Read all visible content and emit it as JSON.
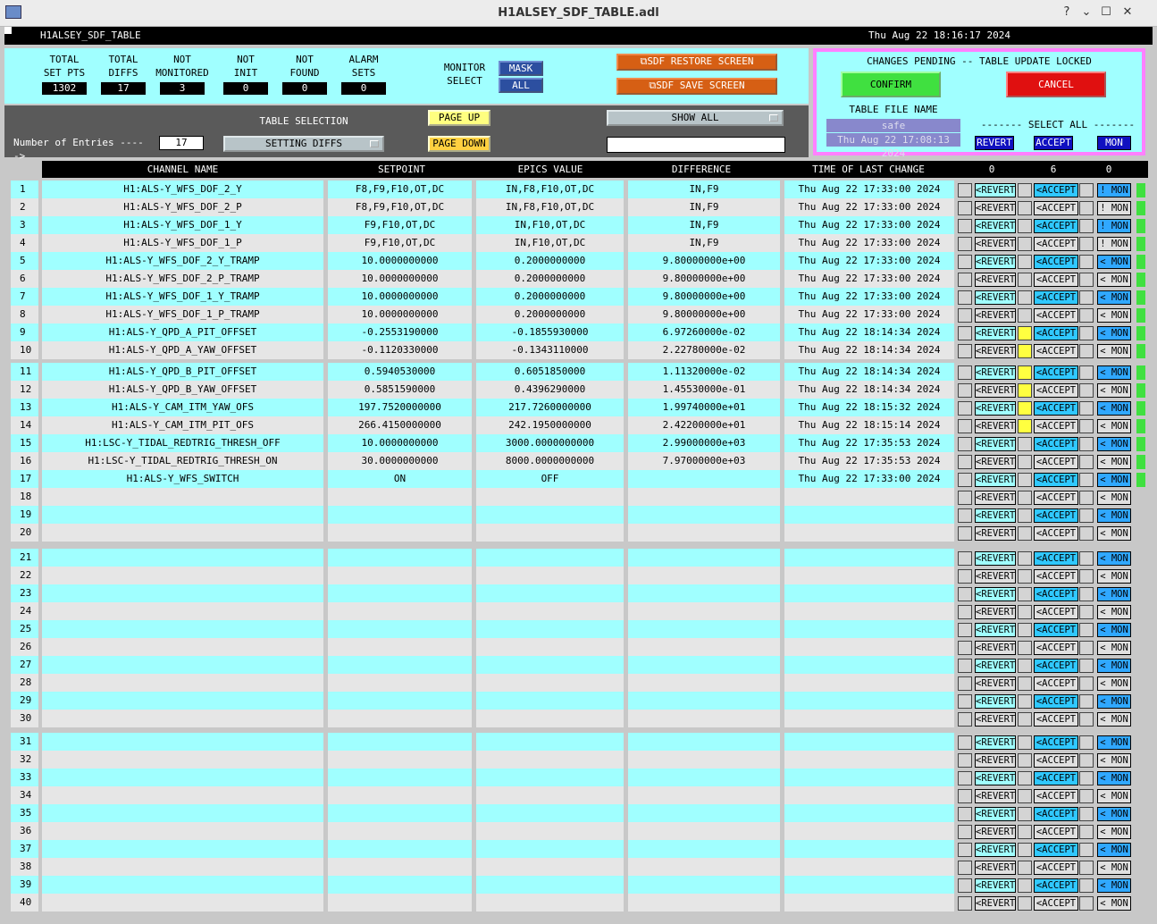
{
  "window": {
    "title": "H1ALSEY_SDF_TABLE.adl"
  },
  "header": {
    "screen_name": "H1ALSEY_SDF_TABLE",
    "datetime": "Thu Aug 22 18:16:17 2024"
  },
  "counters": [
    {
      "label1": "TOTAL",
      "label2": "SET PTS",
      "value": "1302"
    },
    {
      "label1": "TOTAL",
      "label2": "DIFFS",
      "value": "17"
    },
    {
      "label1": "NOT",
      "label2": "MONITORED",
      "value": "3"
    },
    {
      "label1": "NOT",
      "label2": "INIT",
      "value": "0"
    },
    {
      "label1": "NOT",
      "label2": "FOUND",
      "value": "0"
    },
    {
      "label1": "ALARM",
      "label2": "SETS",
      "value": "0"
    }
  ],
  "monitor_select": {
    "label1": "MONITOR",
    "label2": "SELECT",
    "mask": "MASK",
    "all": "ALL"
  },
  "screens": {
    "restore": "SDF RESTORE SCREEN",
    "save": "SDF SAVE SCREEN"
  },
  "pending": {
    "title": "CHANGES PENDING -- TABLE UPDATE LOCKED",
    "confirm": "CONFIRM",
    "cancel": "CANCEL",
    "file_label": "TABLE FILE NAME",
    "file_name": "safe",
    "file_time": "Thu Aug 22 17:08:13 2024",
    "select_all": "------- SELECT ALL -------",
    "revert": "REVERT",
    "accept": "ACCEPT",
    "mon": "MON"
  },
  "table_selection": {
    "label": "TABLE SELECTION",
    "entries_label": "Number of Entries ----->",
    "entries_value": "17",
    "selected": "SETTING DIFFS",
    "page_up": "PAGE UP",
    "page_down": "PAGE DOWN",
    "filter": "SHOW ALL",
    "search": ""
  },
  "columns": {
    "channel": "CHANNEL NAME",
    "setpoint": "SETPOINT",
    "epics": "EPICS VALUE",
    "difference": "DIFFERENCE",
    "time": "TIME OF LAST CHANGE",
    "count_revert": "0",
    "count_accept": "6",
    "count_mon": "0"
  },
  "button_labels": {
    "revert": "<REVERT",
    "accept": "<ACCEPT",
    "mon": "< MON",
    "mon_alt": "! MON"
  },
  "rows": [
    {
      "n": "1",
      "channel": "H1:ALS-Y_WFS_DOF_2_Y",
      "setpoint": "F8,F9,F10,OT,DC",
      "epics": "IN,F8,F10,OT,DC",
      "diff": "IN,F9",
      "time": "Thu Aug 22 17:33:00 2024",
      "sel": false,
      "mon": "!"
    },
    {
      "n": "2",
      "channel": "H1:ALS-Y_WFS_DOF_2_P",
      "setpoint": "F8,F9,F10,OT,DC",
      "epics": "IN,F8,F10,OT,DC",
      "diff": "IN,F9",
      "time": "Thu Aug 22 17:33:00 2024",
      "sel": false,
      "mon": "!"
    },
    {
      "n": "3",
      "channel": "H1:ALS-Y_WFS_DOF_1_Y",
      "setpoint": "F9,F10,OT,DC",
      "epics": "IN,F10,OT,DC",
      "diff": "IN,F9",
      "time": "Thu Aug 22 17:33:00 2024",
      "sel": false,
      "mon": "!"
    },
    {
      "n": "4",
      "channel": "H1:ALS-Y_WFS_DOF_1_P",
      "setpoint": "F9,F10,OT,DC",
      "epics": "IN,F10,OT,DC",
      "diff": "IN,F9",
      "time": "Thu Aug 22 17:33:00 2024",
      "sel": false,
      "mon": "!"
    },
    {
      "n": "5",
      "channel": "H1:ALS-Y_WFS_DOF_2_Y_TRAMP",
      "setpoint": "10.0000000000",
      "epics": "0.2000000000",
      "diff": "9.80000000e+00",
      "time": "Thu Aug 22 17:33:00 2024",
      "sel": false,
      "mon": "<"
    },
    {
      "n": "6",
      "channel": "H1:ALS-Y_WFS_DOF_2_P_TRAMP",
      "setpoint": "10.0000000000",
      "epics": "0.2000000000",
      "diff": "9.80000000e+00",
      "time": "Thu Aug 22 17:33:00 2024",
      "sel": false,
      "mon": "<"
    },
    {
      "n": "7",
      "channel": "H1:ALS-Y_WFS_DOF_1_Y_TRAMP",
      "setpoint": "10.0000000000",
      "epics": "0.2000000000",
      "diff": "9.80000000e+00",
      "time": "Thu Aug 22 17:33:00 2024",
      "sel": false,
      "mon": "<"
    },
    {
      "n": "8",
      "channel": "H1:ALS-Y_WFS_DOF_1_P_TRAMP",
      "setpoint": "10.0000000000",
      "epics": "0.2000000000",
      "diff": "9.80000000e+00",
      "time": "Thu Aug 22 17:33:00 2024",
      "sel": false,
      "mon": "<"
    },
    {
      "n": "9",
      "channel": "H1:ALS-Y_QPD_A_PIT_OFFSET",
      "setpoint": "-0.2553190000",
      "epics": "-0.1855930000",
      "diff": "6.97260000e-02",
      "time": "Thu Aug 22 18:14:34 2024",
      "sel": true,
      "mon": "<"
    },
    {
      "n": "10",
      "channel": "H1:ALS-Y_QPD_A_YAW_OFFSET",
      "setpoint": "-0.1120330000",
      "epics": "-0.1343110000",
      "diff": "2.22780000e-02",
      "time": "Thu Aug 22 18:14:34 2024",
      "sel": true,
      "mon": "<"
    },
    {
      "n": "11",
      "channel": "H1:ALS-Y_QPD_B_PIT_OFFSET",
      "setpoint": "0.5940530000",
      "epics": "0.6051850000",
      "diff": "1.11320000e-02",
      "time": "Thu Aug 22 18:14:34 2024",
      "sel": true,
      "mon": "<"
    },
    {
      "n": "12",
      "channel": "H1:ALS-Y_QPD_B_YAW_OFFSET",
      "setpoint": "0.5851590000",
      "epics": "0.4396290000",
      "diff": "1.45530000e-01",
      "time": "Thu Aug 22 18:14:34 2024",
      "sel": true,
      "mon": "<"
    },
    {
      "n": "13",
      "channel": "H1:ALS-Y_CAM_ITM_YAW_OFS",
      "setpoint": "197.7520000000",
      "epics": "217.7260000000",
      "diff": "1.99740000e+01",
      "time": "Thu Aug 22 18:15:32 2024",
      "sel": true,
      "mon": "<"
    },
    {
      "n": "14",
      "channel": "H1:ALS-Y_CAM_ITM_PIT_OFS",
      "setpoint": "266.4150000000",
      "epics": "242.1950000000",
      "diff": "2.42200000e+01",
      "time": "Thu Aug 22 18:15:14 2024",
      "sel": true,
      "mon": "<"
    },
    {
      "n": "15",
      "channel": "H1:LSC-Y_TIDAL_REDTRIG_THRESH_OFF",
      "setpoint": "10.0000000000",
      "epics": "3000.0000000000",
      "diff": "2.99000000e+03",
      "time": "Thu Aug 22 17:35:53 2024",
      "sel": false,
      "mon": "<"
    },
    {
      "n": "16",
      "channel": "H1:LSC-Y_TIDAL_REDTRIG_THRESH_ON",
      "setpoint": "30.0000000000",
      "epics": "8000.0000000000",
      "diff": "7.97000000e+03",
      "time": "Thu Aug 22 17:35:53 2024",
      "sel": false,
      "mon": "<"
    },
    {
      "n": "17",
      "channel": "H1:ALS-Y_WFS_SWITCH",
      "setpoint": "ON",
      "epics": "OFF",
      "diff": "",
      "time": "Thu Aug 22 17:33:00 2024",
      "sel": false,
      "mon": "<"
    },
    {
      "n": "18"
    },
    {
      "n": "19"
    },
    {
      "n": "20"
    },
    {
      "n": "21"
    },
    {
      "n": "22"
    },
    {
      "n": "23"
    },
    {
      "n": "24"
    },
    {
      "n": "25"
    },
    {
      "n": "26"
    },
    {
      "n": "27"
    },
    {
      "n": "28"
    },
    {
      "n": "29"
    },
    {
      "n": "30"
    },
    {
      "n": "31"
    },
    {
      "n": "32"
    },
    {
      "n": "33"
    },
    {
      "n": "34"
    },
    {
      "n": "35"
    },
    {
      "n": "36"
    },
    {
      "n": "37"
    },
    {
      "n": "38"
    },
    {
      "n": "39"
    },
    {
      "n": "40"
    }
  ],
  "colors": {
    "cyan": "#a0ffff",
    "row_grey": "#e6e6e6",
    "orange": "#d65f14",
    "confirm": "#40e040",
    "cancel": "#e01010",
    "pink": "#ff80ff"
  }
}
